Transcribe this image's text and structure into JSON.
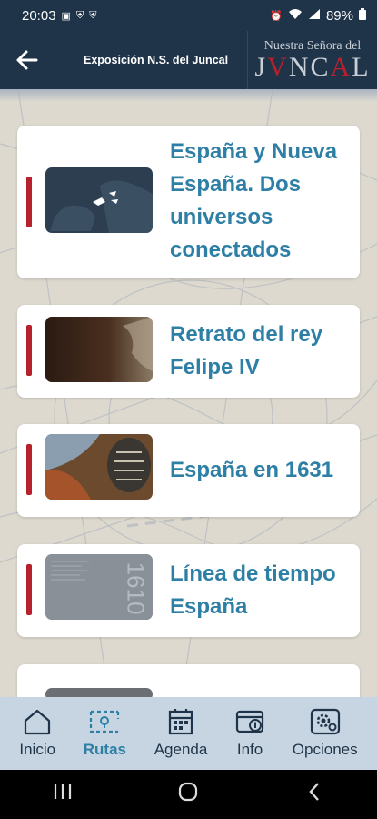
{
  "status_bar": {
    "time": "20:03",
    "battery": "89%"
  },
  "header": {
    "title": "Exposición N.S. del Juncal",
    "logo_line1": "Nuestra Señora del",
    "logo_line2_a": "J",
    "logo_line2_b": "V",
    "logo_line2_c": "NC",
    "logo_line2_d": "A",
    "logo_line2_e": "L"
  },
  "cards": [
    {
      "title": "España y Nueva España. Dos universos conectados"
    },
    {
      "title": "Retrato del rey Felipe IV"
    },
    {
      "title": "España en 1631"
    },
    {
      "title": "Línea de tiempo España"
    }
  ],
  "timeline_thumb_text": "1610",
  "nav": {
    "items": [
      {
        "label": "Inicio",
        "icon": "home-icon"
      },
      {
        "label": "Rutas",
        "icon": "route-icon",
        "active": true
      },
      {
        "label": "Agenda",
        "icon": "calendar-icon"
      },
      {
        "label": "Info",
        "icon": "info-icon"
      },
      {
        "label": "Opciones",
        "icon": "settings-icon"
      }
    ]
  },
  "colors": {
    "header": "#1f3448",
    "accent_red": "#b6212d",
    "title_blue": "#2e7fa6",
    "nav_bg": "#c7d5e2"
  }
}
